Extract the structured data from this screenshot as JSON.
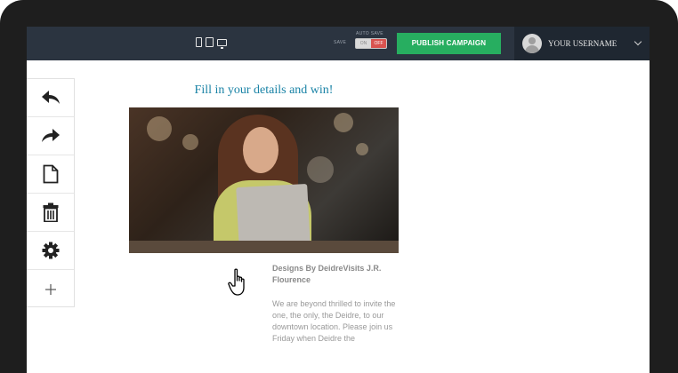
{
  "topbar": {
    "devices": [
      "phone-icon",
      "tablet-icon",
      "desktop-icon"
    ],
    "save_label": "SAVE",
    "autosave_label": "AUTO SAVE",
    "toggle_on": "ON",
    "toggle_off": "OFF",
    "publish_label": "PUBLISH CAMPAIGN",
    "username": "YOUR USERNAME"
  },
  "tools": [
    {
      "name": "undo-icon"
    },
    {
      "name": "redo-icon"
    },
    {
      "name": "new-page-icon"
    },
    {
      "name": "trash-icon"
    },
    {
      "name": "gear-icon"
    },
    {
      "name": "plus-icon"
    }
  ],
  "content": {
    "headline": "Fill in your details and win!",
    "desc_title": "Designs By DeidreVisits J.R. Flourence",
    "desc_body": "We are beyond thrilled to invite the one, the only, the Deidre, to our downtown location. Please join us Friday when Deidre the"
  },
  "colors": {
    "topbar": "#2b3440",
    "publish": "#27ae60",
    "headline": "#1a83a6",
    "toggle_off": "#d9534f"
  }
}
